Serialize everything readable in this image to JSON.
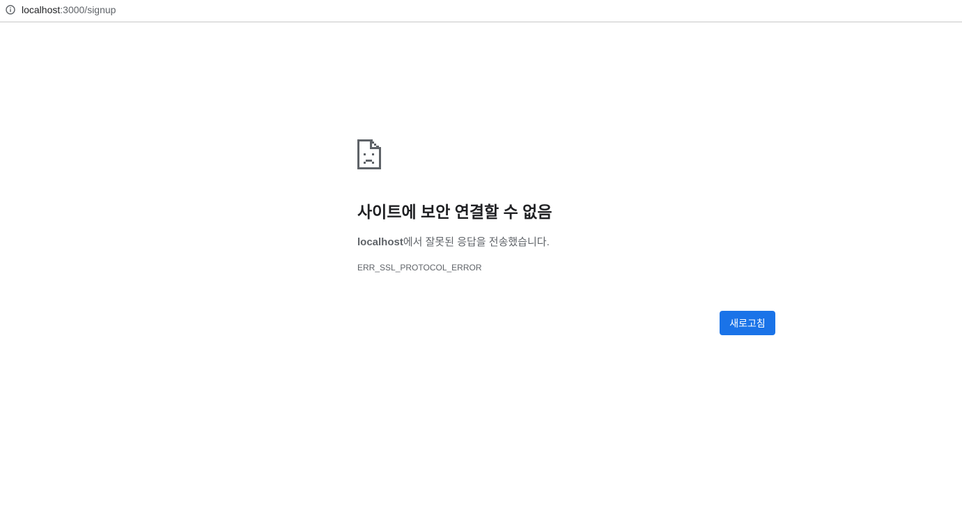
{
  "address_bar": {
    "host": "localhost",
    "path": ":3000/signup",
    "icon": "info-icon"
  },
  "error_page": {
    "icon": "sad-page-icon",
    "heading": "사이트에 보안 연결할 수 없음",
    "summary_host": "localhost",
    "summary_text": "에서 잘못된 응답을 전송했습니다.",
    "error_code": "ERR_SSL_PROTOCOL_ERROR",
    "reload_label": "새로고침"
  },
  "colors": {
    "accent": "#1a73e8",
    "heading_text": "#202124",
    "secondary_text": "#5f6368"
  }
}
